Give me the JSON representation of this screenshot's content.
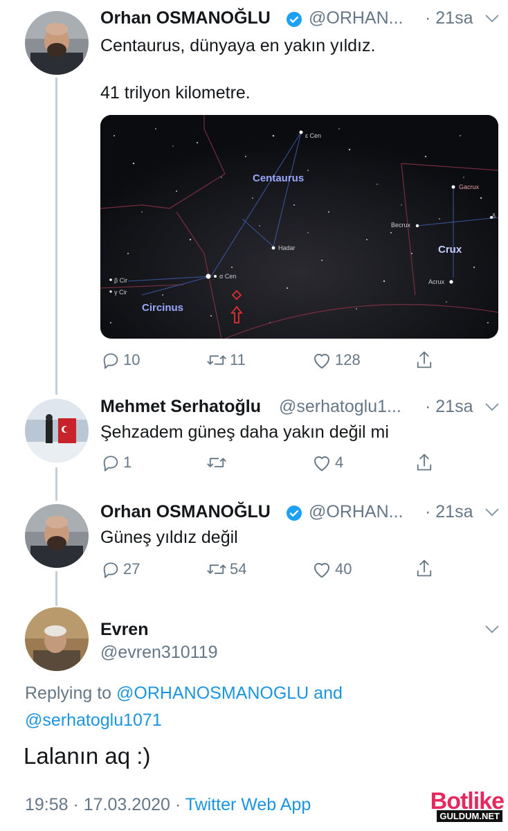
{
  "tweets": [
    {
      "name": "Orhan OSMANOĞLU",
      "handle": "@ORHAN...",
      "time": "· 21sa",
      "lines": [
        "Centaurus, dünyaya en yakın yıldız.",
        "41 trilyon kilometre."
      ],
      "media": {
        "labels": {
          "centaurus": "Centaurus",
          "crux": "Crux",
          "circinus": "Circinus",
          "hadar": "Hadar",
          "cen1": "ε Cen",
          "cen2": "α Cen",
          "gacrux": "Gacrux",
          "becrux": "Becrux",
          "acrux": "Acrux",
          "cir1": "β Cir",
          "cir2": "γ Cir",
          "delta": "δ"
        }
      },
      "actions": {
        "reply": "10",
        "retweet": "11",
        "like": "128"
      }
    },
    {
      "name": "Mehmet Serhatoğlu",
      "handle": "@serhatoglu1...",
      "time": "· 21sa",
      "lines": [
        "Şehzadem güneş daha yakın değil mi"
      ],
      "actions": {
        "reply": "1",
        "retweet": "",
        "like": "4"
      }
    },
    {
      "name": "Orhan OSMANOĞLU",
      "handle": "@ORHAN...",
      "time": "· 21sa",
      "lines": [
        "Güneş yıldız değil"
      ],
      "actions": {
        "reply": "27",
        "retweet": "54",
        "like": "40"
      }
    }
  ],
  "main_tweet": {
    "name": "Evren",
    "handle": "@evren310119",
    "replying_prefix": "Replying to",
    "replying_user1": "@ORHANOSMANOGLU",
    "replying_and": "and",
    "replying_user2": "@serhatoglu1071",
    "text": "Lalanın aq :)",
    "time": "19:58 · 17.03.2020 · ",
    "source": "Twitter Web App"
  },
  "watermark": {
    "brand": "Botlike",
    "site": "GULDUM.NET"
  },
  "colors": {
    "accent": "#1b95e0",
    "muted": "#657786",
    "text": "#14171a",
    "thread": "#c5ced6"
  }
}
